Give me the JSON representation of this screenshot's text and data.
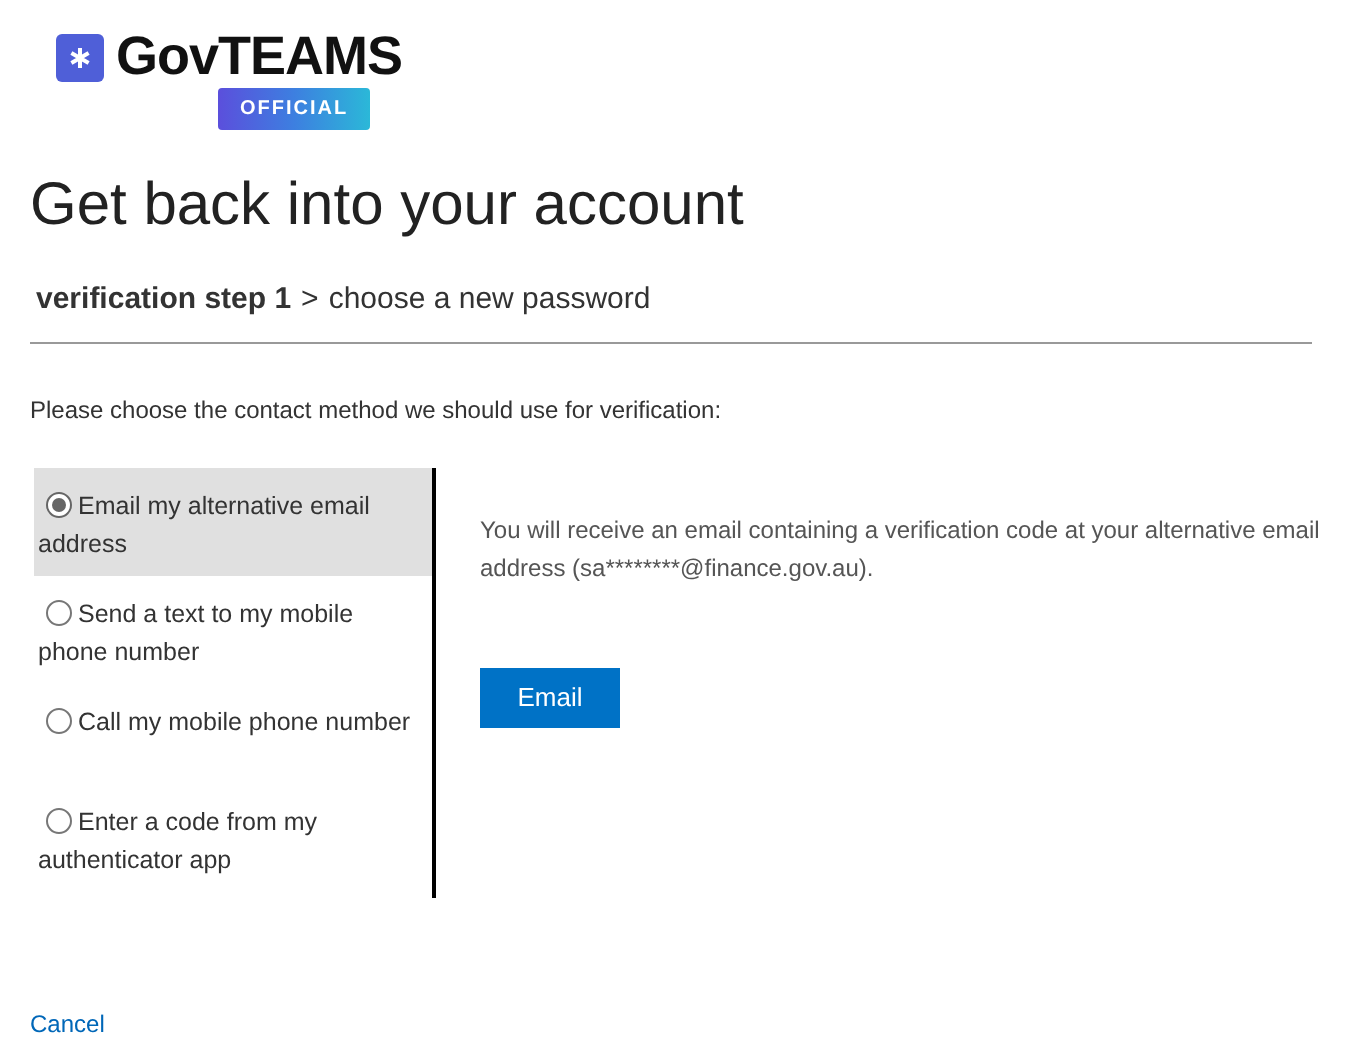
{
  "logo": {
    "name": "GovTEAMS",
    "badge": "OFFICIAL"
  },
  "title": "Get back into your account",
  "steps": {
    "current": "verification step 1",
    "separator": ">",
    "next": "choose a new password"
  },
  "instruction": "Please choose the contact method we should use for verification:",
  "options": [
    {
      "label": "Email my alternative email address",
      "selected": true
    },
    {
      "label": "Send a text to my mobile phone number",
      "selected": false
    },
    {
      "label": "Call my mobile phone number",
      "selected": false
    },
    {
      "label": "Enter a code from my authenticator app",
      "selected": false
    }
  ],
  "detail": "You will receive an email containing a verification code at your alternative email address (sa********@finance.gov.au).",
  "action_button": "Email",
  "cancel_link": "Cancel"
}
